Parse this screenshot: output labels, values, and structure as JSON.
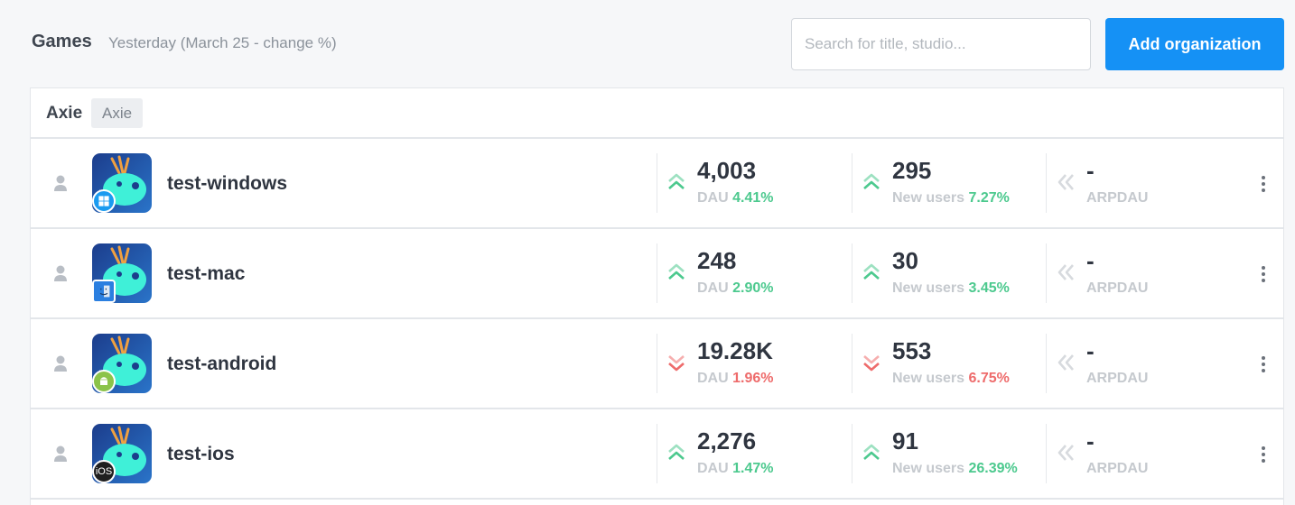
{
  "header": {
    "title": "Games",
    "subtitle": "Yesterday (March 25 - change %)",
    "search_placeholder": "Search for title, studio...",
    "add_button": "Add organization"
  },
  "organization": {
    "name": "Axie",
    "tag": "Axie"
  },
  "colors": {
    "accent": "#1591f5",
    "up": "#4cc98e",
    "down": "#ee6b6b",
    "neutral": "#d7dade"
  },
  "games": [
    {
      "name": "test-windows",
      "platform": "windows",
      "dau": {
        "value": "4,003",
        "label": "DAU",
        "change": "4.41%",
        "trend": "up"
      },
      "new_users": {
        "value": "295",
        "label": "New users",
        "change": "7.27%",
        "trend": "up"
      },
      "arpdau": {
        "value": "-",
        "label": "ARPDAU",
        "trend": "neutral"
      }
    },
    {
      "name": "test-mac",
      "platform": "mac",
      "dau": {
        "value": "248",
        "label": "DAU",
        "change": "2.90%",
        "trend": "up"
      },
      "new_users": {
        "value": "30",
        "label": "New users",
        "change": "3.45%",
        "trend": "up"
      },
      "arpdau": {
        "value": "-",
        "label": "ARPDAU",
        "trend": "neutral"
      }
    },
    {
      "name": "test-android",
      "platform": "android",
      "dau": {
        "value": "19.28K",
        "label": "DAU",
        "change": "1.96%",
        "trend": "down"
      },
      "new_users": {
        "value": "553",
        "label": "New users",
        "change": "6.75%",
        "trend": "down"
      },
      "arpdau": {
        "value": "-",
        "label": "ARPDAU",
        "trend": "neutral"
      }
    },
    {
      "name": "test-ios",
      "platform": "ios",
      "platform_label": "iOS",
      "dau": {
        "value": "2,276",
        "label": "DAU",
        "change": "1.47%",
        "trend": "up"
      },
      "new_users": {
        "value": "91",
        "label": "New users",
        "change": "26.39%",
        "trend": "up"
      },
      "arpdau": {
        "value": "-",
        "label": "ARPDAU",
        "trend": "neutral"
      }
    }
  ]
}
